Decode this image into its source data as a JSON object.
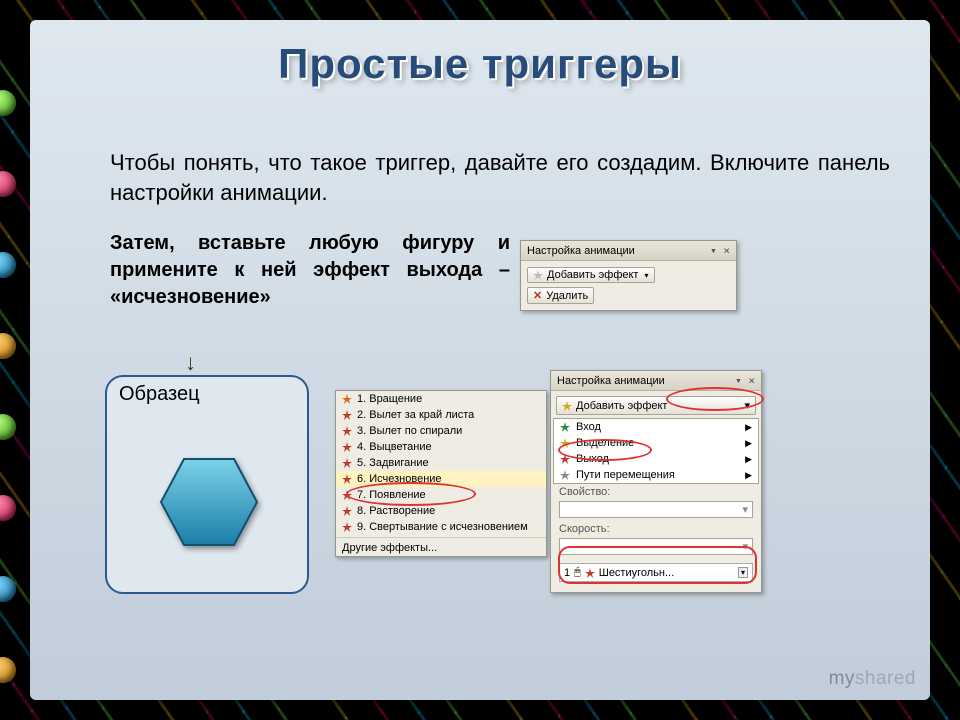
{
  "title": "Простые триггеры",
  "para1_pre": "Чтобы понять, что такое триггер, давайте его создадим.  Включите панель настройки анимации.",
  "para2": "Затем, вставьте любую фигуру и примените к ней эффект выхода – «исчезновение»",
  "sample_label": "Образец",
  "top_panel": {
    "title": "Настройка анимации",
    "add": "Добавить эффект",
    "del": "Удалить"
  },
  "menu_panel": {
    "title": "Настройка анимации",
    "add": "Добавить эффект",
    "items": [
      "Вход",
      "Выделение",
      "Выход",
      "Пути перемещения"
    ],
    "field1": "Свойство:",
    "field2": "Скорость:",
    "effect_num": "1",
    "effect_name": "Шестиугольн..."
  },
  "effects_panel": {
    "items": [
      "1. Вращение",
      "2. Вылет за край листа",
      "3. Вылет по спирали",
      "4. Выцветание",
      "5. Задвигание",
      "6. Исчезновение",
      "7. Появление",
      "8. Растворение",
      "9. Свертывание с исчезновением"
    ],
    "more": "Другие эффекты..."
  },
  "watermark_a": "my",
  "watermark_b": "shared"
}
